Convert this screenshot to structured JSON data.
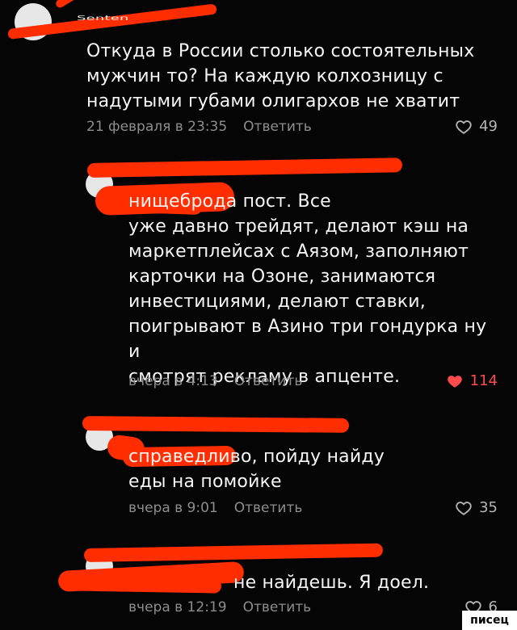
{
  "watermark": {
    "label": "писец"
  },
  "colors": {
    "background": "#050505",
    "text": "#f6f6f6",
    "secondary": "#8d8d8d",
    "accent": "#ff4b4b",
    "redaction": "#ff2d00"
  },
  "comments": [
    {
      "author_partial": "Senten",
      "text": "Откуда в России столько состоятельных\nмужчин то? На каждую колхозницу с\nнадутыми губами олигархов не хватит",
      "time": "21 февраля в 23:35",
      "reply": "Ответить",
      "likes": "49",
      "liked": false
    },
    {
      "text": "нищеброда пост. Все\nуже давно трейдят, делают кэш на\nмаркетплейсах с Аязом, заполняют\nкарточки на Озоне, занимаются\nинвестициями, делают ставки,\nпоигрывают в Азино три гондурка ну и\nсмотрят рекламу в апценте.",
      "time": "вчера в 4:13",
      "reply": "Ответить",
      "likes": "114",
      "liked": true
    },
    {
      "text": "справедливо, пойду найду\nеды на помойке",
      "time": "вчера в 9:01",
      "reply": "Ответить",
      "likes": "35",
      "liked": false
    },
    {
      "text": "не найдешь. Я доел.",
      "time": "вчера в 12:19",
      "reply": "Ответить",
      "likes": "6",
      "liked": false
    }
  ],
  "icons": {
    "like": "heart-icon",
    "liked": "heart-filled-icon"
  }
}
